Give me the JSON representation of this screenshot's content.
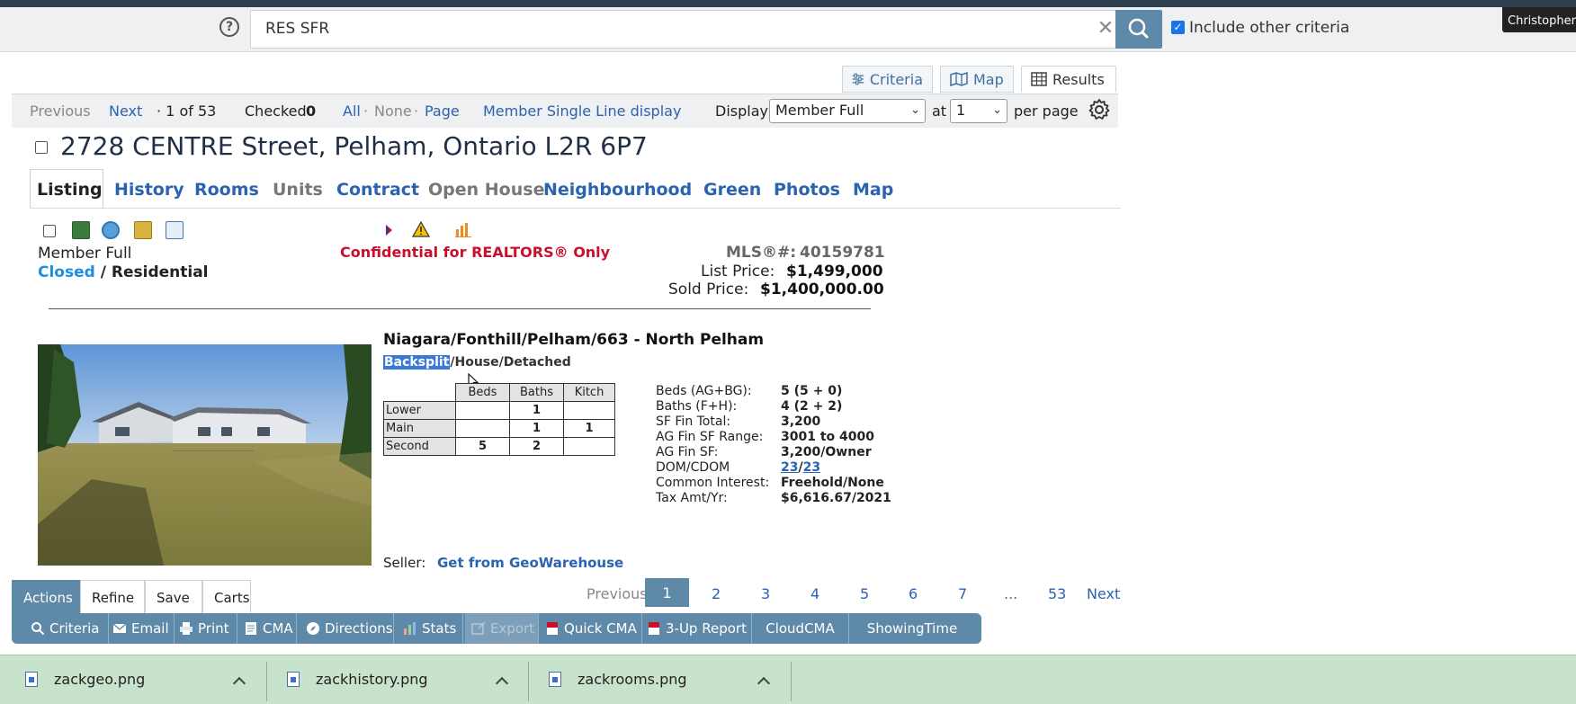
{
  "search": {
    "help_glyph": "?",
    "query": "RES SFR",
    "clear_glyph": "✕",
    "include_label": "Include other criteria",
    "include_checked": true
  },
  "user": {
    "name": "Christopher W"
  },
  "view_tabs": [
    {
      "label": "Criteria",
      "icon": "sliders-icon"
    },
    {
      "label": "Map",
      "icon": "map-icon"
    },
    {
      "label": "Results",
      "icon": "table-icon",
      "active": true
    }
  ],
  "results_nav": {
    "previous": "Previous",
    "next": "Next",
    "position": "· 1 of 53",
    "checked_label": "Checked",
    "checked_count": "0",
    "all": "All",
    "sep1": "·",
    "none": "None",
    "sep2": "·",
    "page": "Page",
    "single_line": "Member Single Line display",
    "display_label": "Display",
    "display_value": "Member Full",
    "at_label": "at",
    "per_page_value": "1",
    "per_page_label": "per page"
  },
  "listing": {
    "title": "2728 CENTRE Street, Pelham, Ontario L2R 6P7",
    "tabs": [
      {
        "label": "Listing",
        "state": "active"
      },
      {
        "label": "History",
        "state": "link"
      },
      {
        "label": "Rooms",
        "state": "link"
      },
      {
        "label": "Units",
        "state": "disabled"
      },
      {
        "label": "Contract",
        "state": "link"
      },
      {
        "label": "Open House",
        "state": "disabled"
      },
      {
        "label": "Neighbourhood",
        "state": "link"
      },
      {
        "label": "Green",
        "state": "link"
      },
      {
        "label": "Photos",
        "state": "link"
      },
      {
        "label": "Map",
        "state": "link"
      }
    ],
    "display_type": "Member Full",
    "status": "Closed",
    "status_sep": "/",
    "class": "Residential",
    "confidential": "Confidential for REALTORS® Only",
    "mls_label": "MLS®#:",
    "mls_number": "40159781",
    "list_price_label": "List Price:",
    "list_price": "$1,499,000",
    "sold_price_label": "Sold Price:",
    "sold_price": "$1,400,000.00",
    "area": "Niagara/Fonthill/Pelham/663 - North Pelham",
    "style_highlight": "Backsplit",
    "style_rest": "/House/Detached",
    "rooms_table": {
      "headers": [
        "Beds",
        "Baths",
        "Kitch"
      ],
      "rows": [
        {
          "level": "Lower",
          "beds": "",
          "baths": "1",
          "kitch": ""
        },
        {
          "level": "Main",
          "beds": "",
          "baths": "1",
          "kitch": "1"
        },
        {
          "level": "Second",
          "beds": "5",
          "baths": "2",
          "kitch": ""
        }
      ]
    },
    "facts": [
      {
        "label": "Beds (AG+BG):",
        "value": "5 (5 + 0)"
      },
      {
        "label": "Baths (F+H):",
        "value": "4 (2 + 2)"
      },
      {
        "label": "SF Fin Total:",
        "value": "3,200"
      },
      {
        "label": "AG Fin SF Range:",
        "value": "3001 to 4000"
      },
      {
        "label": "AG Fin SF:",
        "value": "3,200/Owner"
      },
      {
        "label": "DOM/CDOM",
        "value_a": "23",
        "value_sep": "/",
        "value_b": "23"
      },
      {
        "label": "Common Interest:",
        "value": "Freehold/None"
      },
      {
        "label": "Tax Amt/Yr:",
        "value": "$6,616.67/2021"
      }
    ],
    "seller_label": "Seller:",
    "seller_link": "Get from GeoWarehouse"
  },
  "action_tabs": [
    "Actions",
    "Refine",
    "Save",
    "Carts"
  ],
  "toolbar": [
    {
      "label": "Criteria",
      "icon": "search-icon"
    },
    {
      "label": "Email",
      "icon": "email-icon"
    },
    {
      "label": "Print",
      "icon": "print-icon"
    },
    {
      "label": "CMA",
      "icon": "cma-icon"
    },
    {
      "label": "Directions",
      "icon": "compass-icon"
    },
    {
      "label": "Stats",
      "icon": "bar-chart-icon"
    },
    {
      "label": "Export",
      "icon": "export-icon",
      "disabled": true
    },
    {
      "label": "Quick CMA",
      "icon": "pdf-icon"
    },
    {
      "label": "3-Up Report",
      "icon": "pdf-icon"
    },
    {
      "label": "CloudCMA",
      "icon": ""
    },
    {
      "label": "ShowingTime",
      "icon": ""
    }
  ],
  "pager": {
    "previous": "Previous",
    "current": "1",
    "pages": [
      "2",
      "3",
      "4",
      "5",
      "6",
      "7"
    ],
    "ellipsis": "...",
    "last": "53",
    "next": "Next"
  },
  "downloads": [
    {
      "name": "zackgeo.png"
    },
    {
      "name": "zackhistory.png"
    },
    {
      "name": "zackrooms.png"
    }
  ],
  "colors": {
    "accent": "#5f89a8",
    "link": "#2a63b0",
    "confidential": "#c8102e",
    "closed": "#1e8fe0",
    "download_bar": "#c8e3cb"
  }
}
